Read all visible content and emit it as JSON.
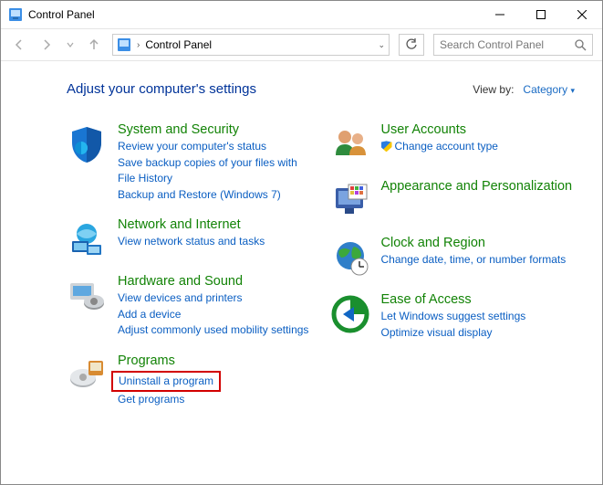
{
  "window": {
    "title": "Control Panel"
  },
  "toolbar": {
    "breadcrumb": "Control Panel",
    "search_placeholder": "Search Control Panel"
  },
  "header": {
    "heading": "Adjust your computer's settings",
    "viewby_label": "View by:",
    "viewby_value": "Category"
  },
  "left": {
    "system": {
      "title": "System and Security",
      "l1": "Review your computer's status",
      "l2": "Save backup copies of your files with File History",
      "l3": "Backup and Restore (Windows 7)"
    },
    "network": {
      "title": "Network and Internet",
      "l1": "View network status and tasks"
    },
    "hardware": {
      "title": "Hardware and Sound",
      "l1": "View devices and printers",
      "l2": "Add a device",
      "l3": "Adjust commonly used mobility settings"
    },
    "programs": {
      "title": "Programs",
      "l1": "Uninstall a program",
      "l2": "Get programs"
    }
  },
  "right": {
    "users": {
      "title": "User Accounts",
      "l1": "Change account type"
    },
    "appearance": {
      "title": "Appearance and Personalization"
    },
    "clock": {
      "title": "Clock and Region",
      "l1": "Change date, time, or number formats"
    },
    "ease": {
      "title": "Ease of Access",
      "l1": "Let Windows suggest settings",
      "l2": "Optimize visual display"
    }
  }
}
